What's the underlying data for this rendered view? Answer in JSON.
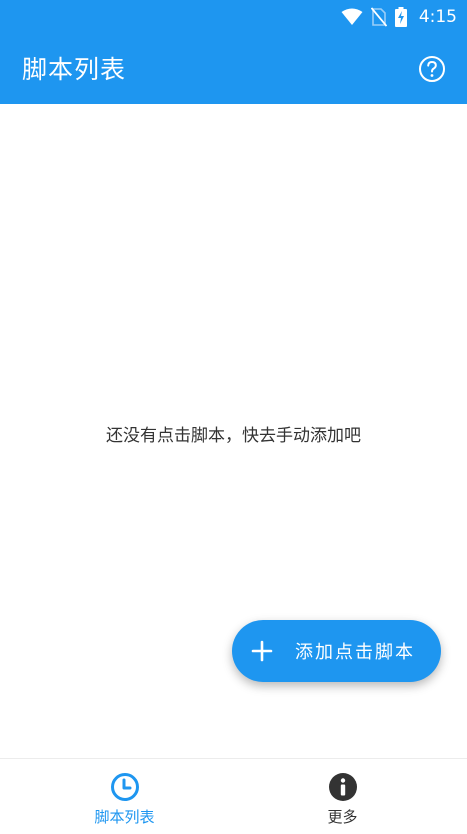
{
  "status_bar": {
    "time": "4:15",
    "icons": [
      "wifi-icon",
      "no-sim-icon",
      "battery-charging-icon"
    ]
  },
  "app_bar": {
    "title": "脚本列表",
    "help_icon": "help-circle-icon"
  },
  "main": {
    "empty_message": "还没有点击脚本，快去手动添加吧"
  },
  "fab": {
    "icon": "plus-icon",
    "label": "添加点击脚本"
  },
  "bottom_nav": {
    "items": [
      {
        "label": "脚本列表",
        "icon": "clock-icon",
        "active": true
      },
      {
        "label": "更多",
        "icon": "info-icon",
        "active": false
      }
    ]
  },
  "colors": {
    "primary": "#1e96f0",
    "text": "#333333",
    "inactive_icon": "#333333"
  }
}
